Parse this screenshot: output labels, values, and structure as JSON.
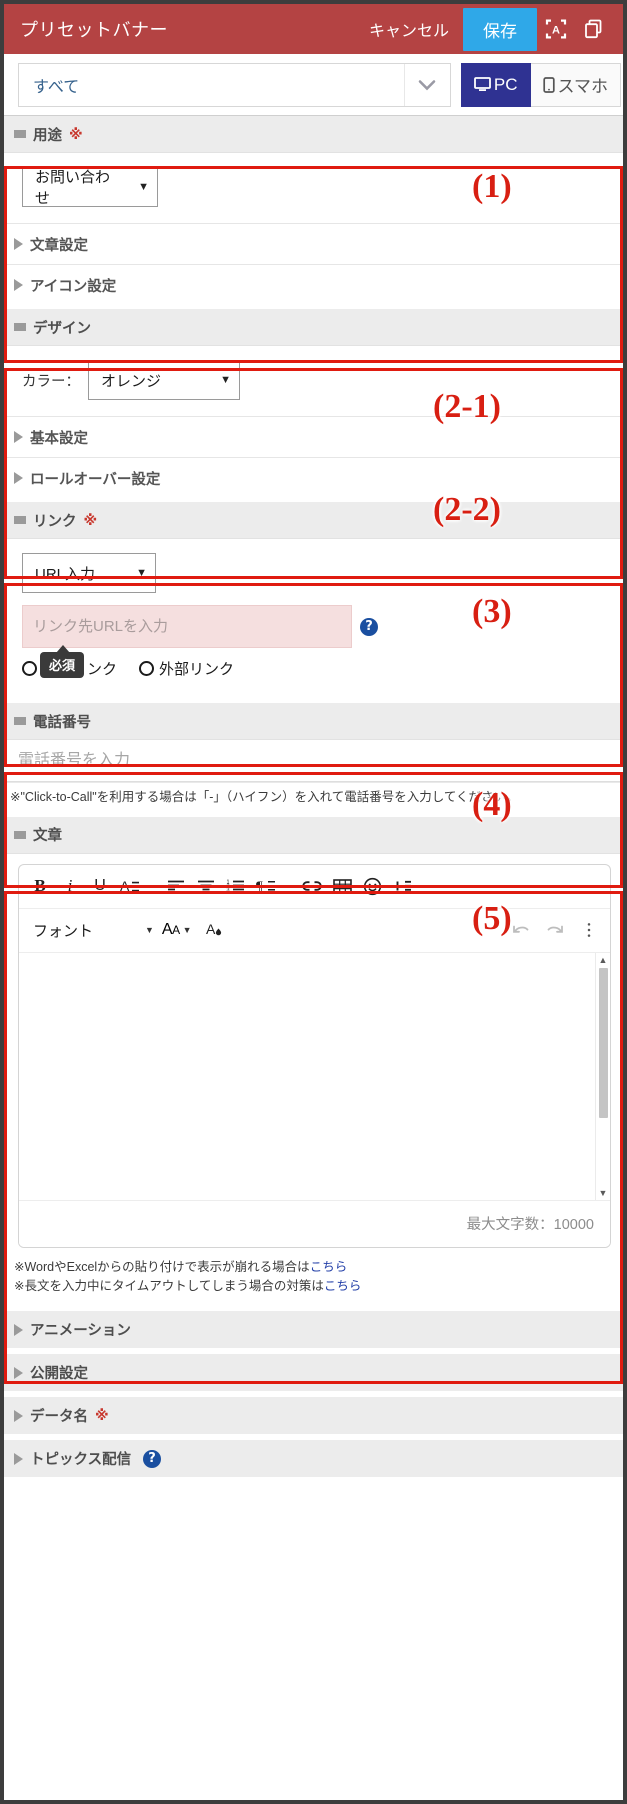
{
  "titlebar": {
    "title": "プリセットバナー",
    "cancel_label": "キャンセル",
    "save_label": "保存",
    "scan_icon": "scan-text-icon",
    "duplicate_icon": "duplicate-icon"
  },
  "filterbar": {
    "filter_value": "すべて",
    "device_pc_label": "PC",
    "device_sp_label": "スマホ"
  },
  "sections": {
    "purpose": {
      "title": "用途",
      "required_mark": "※",
      "select_value": "お問い合わせ",
      "sub_text_settings": "文章設定",
      "sub_icon_settings": "アイコン設定"
    },
    "design": {
      "title": "デザイン",
      "color_label": "カラー：",
      "color_value": "オレンジ",
      "sub_basic": "基本設定",
      "sub_rollover": "ロールオーバー設定"
    },
    "link": {
      "title": "リンク",
      "required_mark": "※",
      "type_value": "URL入力",
      "url_placeholder": "リンク先URLを入力",
      "url_value": "",
      "tooltip": "必須",
      "radio_internal": "内部リンク",
      "radio_external": "外部リンク",
      "help_icon": "help-circle-icon"
    },
    "tel": {
      "title": "電話番号",
      "placeholder": "電話番号を入力",
      "value": "",
      "note": "※\"Click-to-Call\"を利用する場合は「-」（ハイフン）を入れて電話番号を入力してください。"
    },
    "text": {
      "title": "文章",
      "toolbar_row1": [
        {
          "name": "bold-icon",
          "glyph": "B"
        },
        {
          "name": "italic-icon",
          "glyph": "i"
        },
        {
          "name": "underline-icon",
          "glyph": "U"
        },
        {
          "name": "text-color-icon",
          "glyph": "A"
        },
        {
          "name": "align-left-icon",
          "glyph": ""
        },
        {
          "name": "align-center-icon",
          "glyph": ""
        },
        {
          "name": "numbered-list-icon",
          "glyph": ""
        },
        {
          "name": "paragraph-icon",
          "glyph": "¶"
        },
        {
          "name": "link-icon",
          "glyph": ""
        },
        {
          "name": "table-icon",
          "glyph": ""
        },
        {
          "name": "emoji-icon",
          "glyph": "☺"
        },
        {
          "name": "insert-more-icon",
          "glyph": "+"
        }
      ],
      "font_name": "フォント",
      "font_size_icon": "font-size-icon",
      "highlight_icon": "highlight-color-icon",
      "undo_icon": "undo-icon",
      "redo_icon": "redo-icon",
      "overflow_icon": "more-vertical-icon",
      "body_value": "",
      "max_chars_label": "最大文字数：10000",
      "note1_prefix": "※WordやExcelからの貼り付けで表示が崩れる場合は",
      "note1_link": "こちら",
      "note2_prefix": "※長文を入力中にタイムアウトしてしまう場合の対策は",
      "note2_link": "こちら"
    }
  },
  "collapsed": [
    {
      "title": "アニメーション",
      "required_mark": "",
      "help": false
    },
    {
      "title": "公開設定",
      "required_mark": "",
      "help": false
    },
    {
      "title": "データ名",
      "required_mark": "※",
      "help": false
    },
    {
      "title": "トピックス配信",
      "required_mark": "",
      "help": true
    }
  ],
  "annotations": [
    {
      "label": "(1)"
    },
    {
      "label": "(2-1)"
    },
    {
      "label": "(2-2)"
    },
    {
      "label": "(3)"
    },
    {
      "label": "(4)"
    },
    {
      "label": "(5)"
    }
  ],
  "colors": {
    "titlebar": "#b44343",
    "save": "#2fa8e8",
    "device_active": "#2f3292",
    "annotation": "#e01b10",
    "required": "#c8372d"
  }
}
